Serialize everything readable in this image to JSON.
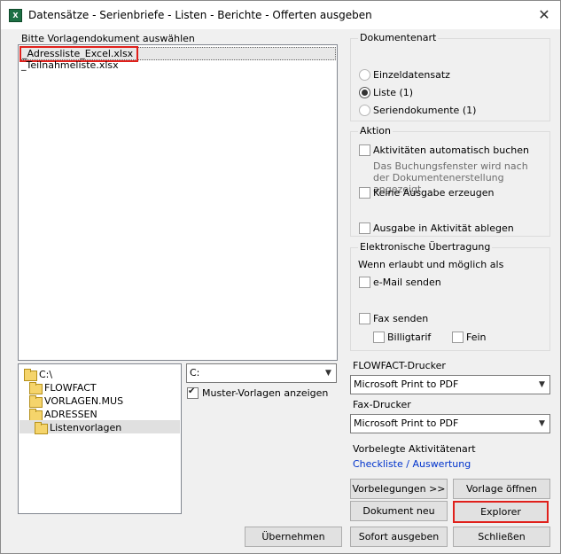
{
  "window": {
    "title": "Datensätze - Serienbriefe - Listen - Berichte - Offerten ausgeben",
    "close_glyph": "✕"
  },
  "templates": {
    "label": "Bitte Vorlagendokument auswählen",
    "files": [
      "_Adressliste_Excel.xlsx",
      "_Teilnahmeliste.xlsx"
    ]
  },
  "folders": {
    "items": [
      "C:\\",
      "FLOWFACT",
      "VORLAGEN.MUS",
      "ADRESSEN",
      "Listenvorlagen"
    ],
    "drive": "C:",
    "show_templates_label": "Muster-Vorlagen anzeigen"
  },
  "doc_type": {
    "label": "Dokumentenart",
    "options": [
      "Einzeldatensatz",
      "Liste (1)",
      "Seriendokumente (1)"
    ],
    "selected": "Liste (1)"
  },
  "action": {
    "label": "Aktion",
    "auto_book": "Aktivitäten automatisch buchen",
    "auto_book_note": "Das Buchungsfenster wird nach der Dokumentenerstellung angezeigt.",
    "no_output": "Keine Ausgabe erzeugen",
    "store_in_activity": "Ausgabe in Aktivität ablegen"
  },
  "electronic": {
    "label": "Elektronische Übertragung",
    "note": "Wenn erlaubt und möglich als",
    "email": "e-Mail senden",
    "fax": "Fax senden",
    "cheap": "Billigtarif",
    "fine": "Fein"
  },
  "printers": {
    "flowfact_label": "FLOWFACT-Drucker",
    "flowfact_value": "Microsoft Print to PDF",
    "fax_label": "Fax-Drucker",
    "fax_value": "Microsoft Print to PDF",
    "activity_label": "Vorbelegte Aktivitätenart",
    "activity_link": "Checkliste / Auswertung"
  },
  "buttons": {
    "defaults": "Vorbelegungen >>",
    "open_template": "Vorlage öffnen",
    "new_document": "Dokument neu",
    "explorer": "Explorer",
    "apply": "Übernehmen",
    "output_now": "Sofort ausgeben",
    "close": "Schließen"
  },
  "icons": {
    "app": "X",
    "dropdown": "▼",
    "check": "✔"
  },
  "colors": {
    "highlight": "#e0201b",
    "link": "#0033cc"
  }
}
